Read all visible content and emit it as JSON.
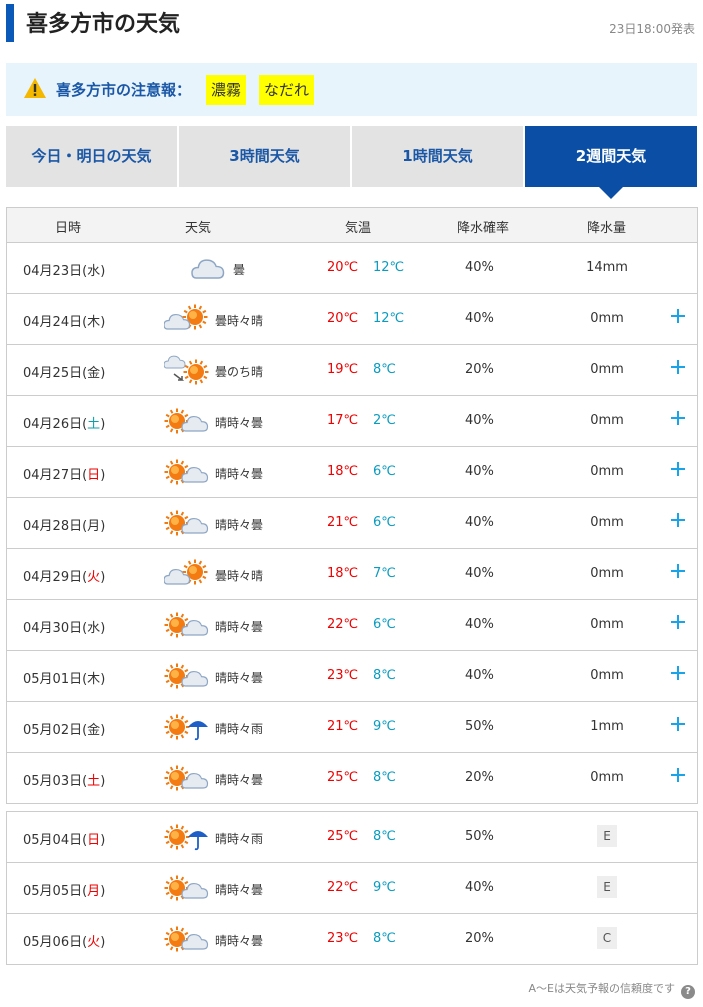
{
  "header": {
    "title": "喜多方市の天気",
    "issued": "23日18:00発表"
  },
  "alert": {
    "label": "喜多方市の注意報：",
    "warnings": [
      "濃霧",
      "なだれ"
    ]
  },
  "tabs": [
    "今日・明日の天気",
    "3時間天気",
    "1時間天気",
    "2週間天気"
  ],
  "active_tab": "2週間天気",
  "table_header": {
    "date": "日時",
    "weather": "天気",
    "temp": "気温",
    "precip_prob": "降水確率",
    "precip_amount": "降水量"
  },
  "rows": [
    {
      "date": "04月23日",
      "dow": "水",
      "weather": "曇",
      "icon": "cloudy-icon",
      "hi": "20℃",
      "lo": "12℃",
      "prob": "40%",
      "amount": "14mm"
    },
    {
      "date": "04月24日",
      "dow": "木",
      "weather": "曇時々晴",
      "icon": "cloudy-sometimes-sunny-icon",
      "hi": "20℃",
      "lo": "12℃",
      "prob": "40%",
      "amount": "0mm"
    },
    {
      "date": "04月25日",
      "dow": "金",
      "weather": "曇のち晴",
      "icon": "cloudy-then-sunny-icon",
      "hi": "19℃",
      "lo": "8℃",
      "prob": "20%",
      "amount": "0mm"
    },
    {
      "date": "04月26日",
      "dow": "土",
      "weather": "晴時々曇",
      "icon": "sunny-sometimes-cloudy-icon",
      "hi": "17℃",
      "lo": "2℃",
      "prob": "40%",
      "amount": "0mm"
    },
    {
      "date": "04月27日",
      "dow": "日",
      "weather": "晴時々曇",
      "icon": "sunny-sometimes-cloudy-icon",
      "hi": "18℃",
      "lo": "6℃",
      "prob": "40%",
      "amount": "0mm"
    },
    {
      "date": "04月28日",
      "dow": "月",
      "weather": "晴時々曇",
      "icon": "sunny-sometimes-cloudy-icon",
      "hi": "21℃",
      "lo": "6℃",
      "prob": "40%",
      "amount": "0mm"
    },
    {
      "date": "04月29日",
      "dow": "火",
      "weather": "曇時々晴",
      "icon": "cloudy-sometimes-sunny-icon",
      "hi": "18℃",
      "lo": "7℃",
      "prob": "40%",
      "amount": "0mm"
    },
    {
      "date": "04月30日",
      "dow": "水",
      "weather": "晴時々曇",
      "icon": "sunny-sometimes-cloudy-icon",
      "hi": "22℃",
      "lo": "6℃",
      "prob": "40%",
      "amount": "0mm"
    },
    {
      "date": "05月01日",
      "dow": "木",
      "weather": "晴時々曇",
      "icon": "sunny-sometimes-cloudy-icon",
      "hi": "23℃",
      "lo": "8℃",
      "prob": "40%",
      "amount": "0mm"
    },
    {
      "date": "05月02日",
      "dow": "金",
      "weather": "晴時々雨",
      "icon": "sunny-sometimes-rain-icon",
      "hi": "21℃",
      "lo": "9℃",
      "prob": "50%",
      "amount": "1mm"
    },
    {
      "date": "05月03日",
      "dow": "土",
      "weather": "晴時々曇",
      "icon": "sunny-sometimes-cloudy-icon",
      "hi": "25℃",
      "lo": "8℃",
      "prob": "20%",
      "amount": "0mm"
    }
  ],
  "rows2": [
    {
      "date": "05月04日",
      "dow": "日",
      "weather": "晴時々雨",
      "icon": "sunny-sometimes-rain-icon",
      "hi": "25℃",
      "lo": "8℃",
      "prob": "50%",
      "reliability": "E"
    },
    {
      "date": "05月05日",
      "dow": "月",
      "weather": "晴時々曇",
      "icon": "sunny-sometimes-cloudy-icon",
      "hi": "22℃",
      "lo": "9℃",
      "prob": "40%",
      "reliability": "E"
    },
    {
      "date": "05月06日",
      "dow": "火",
      "weather": "晴時々曇",
      "icon": "sunny-sometimes-cloudy-icon",
      "hi": "23℃",
      "lo": "8℃",
      "prob": "20%",
      "reliability": "C"
    }
  ],
  "footer": {
    "note": "A〜Eは天気予報の信頼度です",
    "help": "?"
  },
  "colors": {
    "accent": "#0a4fa5",
    "high_temp": "#e00000",
    "low_temp": "#0a9bbf",
    "plus": "#19a3e8",
    "saturday": "#0aa0a8",
    "sunday": "#e00000"
  }
}
